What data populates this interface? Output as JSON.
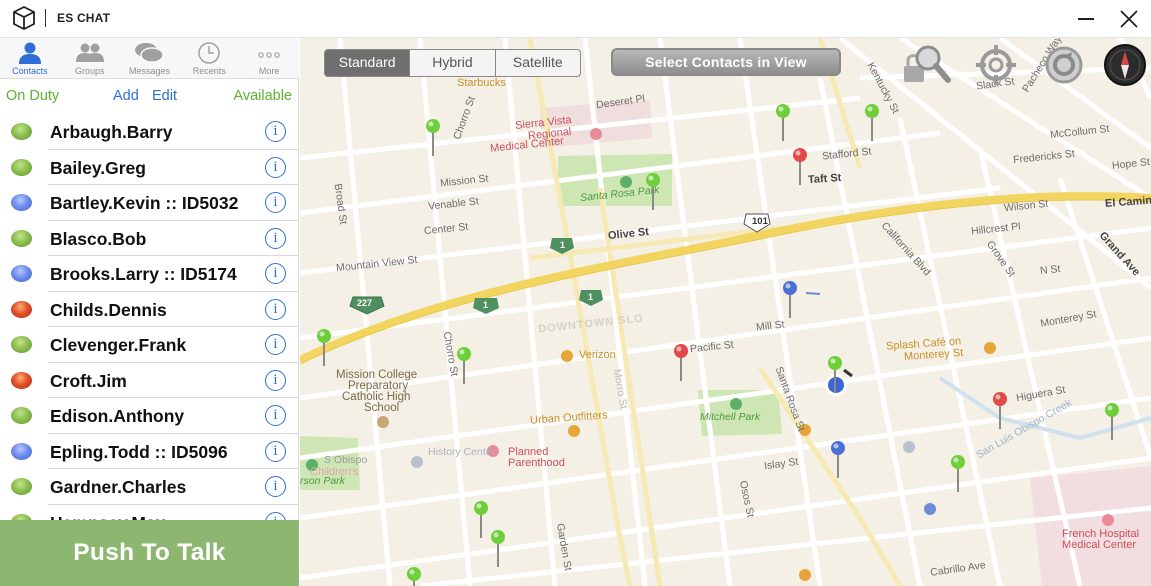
{
  "app": {
    "title": "ES CHAT"
  },
  "tabs": [
    {
      "label": "Contacts",
      "icon": "person-icon",
      "active": true
    },
    {
      "label": "Groups",
      "icon": "group-icon"
    },
    {
      "label": "Messages",
      "icon": "chat-bubbles-icon"
    },
    {
      "label": "Recents",
      "icon": "clock-icon"
    },
    {
      "label": "More",
      "icon": "more-dots-icon"
    }
  ],
  "status": {
    "on_duty": "On Duty",
    "add": "Add",
    "edit": "Edit",
    "available": "Available"
  },
  "contacts": [
    {
      "name": "Arbaugh.Barry",
      "status": "green"
    },
    {
      "name": "Bailey.Greg",
      "status": "green"
    },
    {
      "name": "Bartley.Kevin :: ID5032",
      "status": "blue"
    },
    {
      "name": "Blasco.Bob",
      "status": "green"
    },
    {
      "name": "Brooks.Larry :: ID5174",
      "status": "blue"
    },
    {
      "name": "Childs.Dennis",
      "status": "red"
    },
    {
      "name": "Clevenger.Frank",
      "status": "green"
    },
    {
      "name": "Croft.Jim",
      "status": "red"
    },
    {
      "name": "Edison.Anthony",
      "status": "green"
    },
    {
      "name": "Epling.Todd :: ID5096",
      "status": "blue"
    },
    {
      "name": "Gardner.Charles",
      "status": "green"
    },
    {
      "name": "Hempsey.Max",
      "status": "green"
    }
  ],
  "info_glyph": "i",
  "push_to_talk": "Push To Talk",
  "map": {
    "map_types": [
      "Standard",
      "Hybrid",
      "Satellite"
    ],
    "selected_map_type": "Standard",
    "select_contacts_label": "Select Contacts in View",
    "colors": {
      "route": "#f2d561",
      "park": "#cde6b4",
      "pin_green": "#6fcf3b",
      "pin_red": "#e24a4a",
      "pin_blue": "#4a6fd6"
    },
    "labels": {
      "starbucks": "Starbucks",
      "deseret": "Deseret Pl",
      "sierra1": "Sierra Vista",
      "sierra2": "Regional",
      "sierra3": "Medical Center",
      "santa_rosa_park": "Santa Rosa Park",
      "mission": "Mission St",
      "venable": "Venable St",
      "center": "Center St",
      "olive": "Olive St",
      "mountain_view": "Mountain View St",
      "broad": "Broad St",
      "chorro": "Chorro St",
      "chorro2": "Chorro St",
      "stafford": "Stafford St",
      "taft": "Taft St",
      "slack": "Slack St",
      "pacheco": "Pacheco Way",
      "kentucky": "Kentucky St",
      "mccollum": "McCollum St",
      "fredericks": "Fredericks St",
      "hope": "Hope St",
      "wilson": "Wilson St",
      "hillcrest": "Hillcrest Pl",
      "el_camino": "El Camino",
      "california": "California Blvd",
      "grove": "Grove St",
      "n_st": "N St",
      "grand": "Grand Ave",
      "hwy101": "101",
      "hwy227": "227",
      "hwy1": "1",
      "mill": "Mill St",
      "monterey": "Monterey St",
      "pacific": "Pacific St",
      "splash1": "Splash Café on",
      "splash2": "Monterey St",
      "verizon": "Verizon",
      "mission_college1": "Mission College",
      "mission_college2": "Preparatory",
      "mission_college3": "Catholic High",
      "mission_college4": "School",
      "urban": "Urban Outfitters",
      "mitchell": "Mitchell Park",
      "planned1": "Planned",
      "planned2": "Parenthood",
      "history": "History Center",
      "islay": "Islay St",
      "osos": "Osos St",
      "higuera": "Higuera St",
      "garden": "Garden St",
      "santa_rosa_st": "Santa Rosa St",
      "morro": "Morro St",
      "french1": "French Hospital",
      "french2": "Medical Center",
      "slo_creek": "San Luis Obispo Creek",
      "childrens": "Children's",
      "son_park": "rson Park",
      "slo": "S Obispo",
      "cabrillo": "Cabrillo Ave",
      "downtown": "DOWNTOWN SLO"
    }
  }
}
